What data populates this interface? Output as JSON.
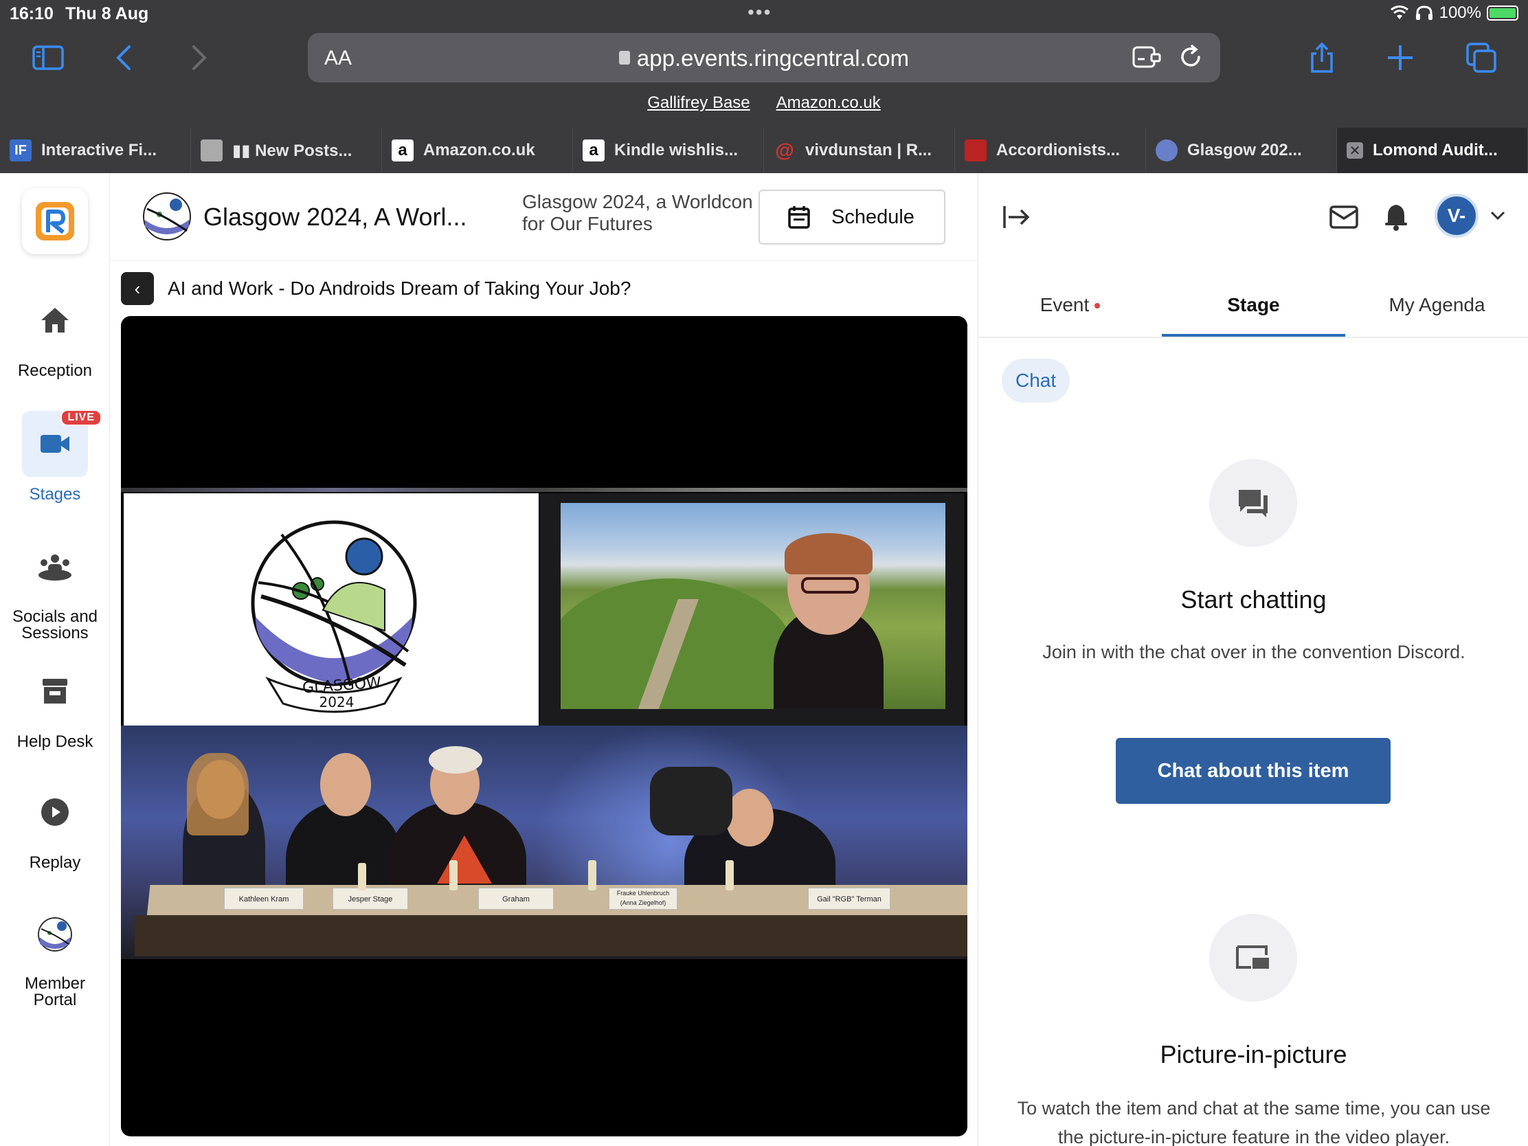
{
  "statusbar": {
    "time": "16:10",
    "date": "Thu 8 Aug",
    "battery": "100%"
  },
  "browser": {
    "url_aa": "AA",
    "url": "app.events.ringcentral.com",
    "bookmarks": [
      "Gallifrey Base",
      "Amazon.co.uk"
    ],
    "tabs": [
      {
        "label": "Interactive Fi...",
        "icon": "if-icon"
      },
      {
        "label": "▮▮ New Posts...",
        "icon": "forum-icon"
      },
      {
        "label": "Amazon.co.uk",
        "icon": "amazon-icon"
      },
      {
        "label": "Kindle wishlis...",
        "icon": "amazon-icon"
      },
      {
        "label": "vivdunstan | R...",
        "icon": "swirl-icon"
      },
      {
        "label": "Accordionists...",
        "icon": "accordion-icon"
      },
      {
        "label": "Glasgow 202...",
        "icon": "glasgow-icon"
      },
      {
        "label": "Lomond Audit...",
        "icon": "close-icon"
      }
    ]
  },
  "nav": {
    "items": [
      {
        "label": "Reception",
        "icon": "home-icon"
      },
      {
        "label": "Stages",
        "icon": "video-camera-icon",
        "badge": "LIVE"
      },
      {
        "label": "Socials and Sessions",
        "icon": "people-icon"
      },
      {
        "label": "Help Desk",
        "icon": "booth-icon"
      },
      {
        "label": "Replay",
        "icon": "play-icon"
      },
      {
        "label": "Member Portal",
        "icon": "glasgow-logo-icon"
      }
    ]
  },
  "event": {
    "title": "Glasgow 2024, A Worl...",
    "subtitle": "Glasgow 2024, a Worldcon for Our Futures",
    "schedule_label": "Schedule",
    "session_title": "AI and Work - Do Androids Dream of Taking Your Job?"
  },
  "video": {
    "logo_text": "GLASGOW",
    "logo_year": "2024",
    "nameplates": [
      "Kathleen Kram",
      "Jesper Stage",
      "Graham",
      "Frauke Uhlenbruch (Anna Ziegelhof)",
      "Gail \"RGB\" Terman"
    ]
  },
  "right": {
    "avatar": "V-",
    "tabs": [
      "Event",
      "Stage",
      "My Agenda"
    ],
    "chat_chip": "Chat",
    "start_heading": "Start chatting",
    "start_text": "Join in with the chat over in the convention Discord.",
    "chat_button": "Chat about this item",
    "pip_heading": "Picture-in-picture",
    "pip_text": "To watch the item and chat at the same time, you can use the picture-in-picture feature in the video player."
  },
  "colors": {
    "accent": "#2a6db5",
    "button": "#2f5f9e",
    "live": "#e04040",
    "chrome": "#3b3b3d"
  }
}
